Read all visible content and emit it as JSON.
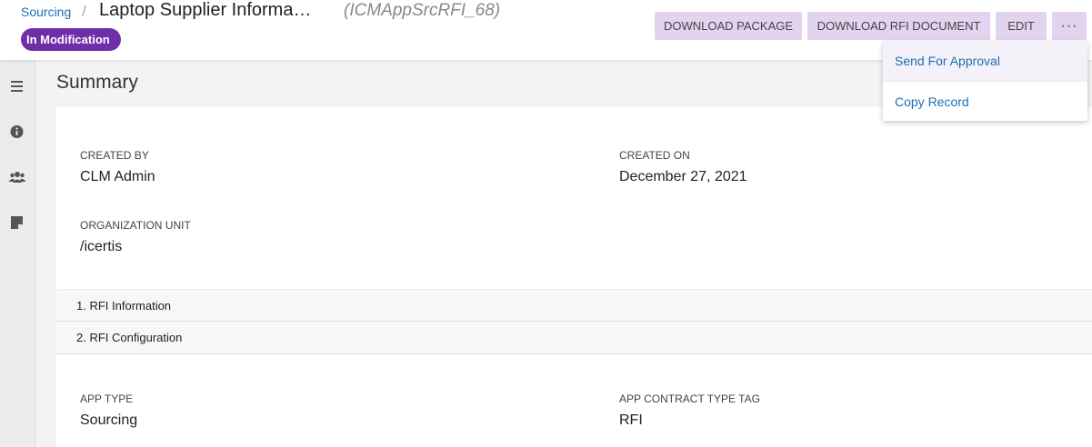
{
  "header": {
    "breadcrumb": "Sourcing",
    "separator": "/",
    "title": "Laptop Supplier Informa…",
    "record_code": "(ICMAppSrcRFI_68)",
    "status_badge": "In Modification"
  },
  "toolbar": {
    "download_package": "DOWNLOAD PACKAGE",
    "download_rfi": "DOWNLOAD RFI DOCUMENT",
    "edit": "EDIT",
    "more": "···"
  },
  "more_menu": {
    "items": [
      "Send For Approval",
      "Copy Record"
    ]
  },
  "rail": {
    "icons": [
      "menu-icon",
      "info-icon",
      "team-icon",
      "note-icon"
    ]
  },
  "summary": {
    "title": "Summary",
    "fields": [
      {
        "label": "CREATED BY",
        "value": "CLM Admin"
      },
      {
        "label": "CREATED ON",
        "value": "December 27, 2021"
      },
      {
        "label": "ORGANIZATION UNIT",
        "value": "/icertis"
      }
    ],
    "sections": [
      "1. RFI Information",
      "2. RFI Configuration"
    ],
    "more_fields": [
      {
        "label": "APP TYPE",
        "value": "Sourcing"
      },
      {
        "label": "APP CONTRACT TYPE TAG",
        "value": "RFI"
      }
    ]
  },
  "colors": {
    "accent": "#6f2da8",
    "button_bg": "#e2d3ef",
    "link": "#1b6fb5"
  }
}
